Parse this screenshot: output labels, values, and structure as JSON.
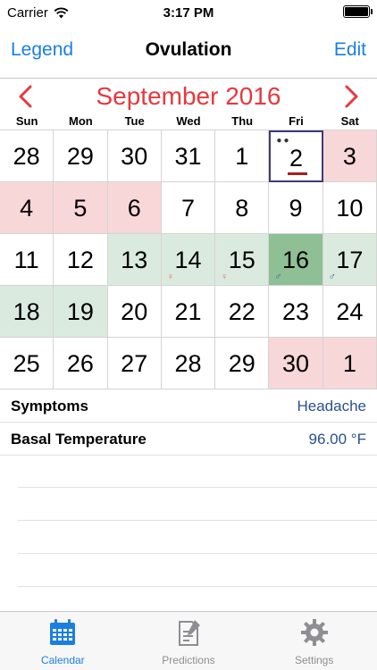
{
  "status_bar": {
    "carrier": "Carrier",
    "time": "3:17 PM"
  },
  "nav": {
    "left_label": "Legend",
    "title": "Ovulation",
    "right_label": "Edit"
  },
  "calendar": {
    "month_title": "September 2016",
    "weekdays": [
      "Sun",
      "Mon",
      "Tue",
      "Wed",
      "Thu",
      "Fri",
      "Sat"
    ],
    "weeks": [
      [
        {
          "day": "28",
          "state": "normal",
          "mark": ""
        },
        {
          "day": "29",
          "state": "normal",
          "mark": ""
        },
        {
          "day": "30",
          "state": "normal",
          "mark": ""
        },
        {
          "day": "31",
          "state": "normal",
          "mark": ""
        },
        {
          "day": "1",
          "state": "normal",
          "mark": ""
        },
        {
          "day": "2",
          "state": "today",
          "mark": ""
        },
        {
          "day": "3",
          "state": "period",
          "mark": ""
        }
      ],
      [
        {
          "day": "4",
          "state": "period",
          "mark": ""
        },
        {
          "day": "5",
          "state": "period",
          "mark": ""
        },
        {
          "day": "6",
          "state": "period",
          "mark": ""
        },
        {
          "day": "7",
          "state": "normal",
          "mark": ""
        },
        {
          "day": "8",
          "state": "normal",
          "mark": ""
        },
        {
          "day": "9",
          "state": "normal",
          "mark": ""
        },
        {
          "day": "10",
          "state": "normal",
          "mark": ""
        }
      ],
      [
        {
          "day": "11",
          "state": "normal",
          "mark": ""
        },
        {
          "day": "12",
          "state": "normal",
          "mark": ""
        },
        {
          "day": "13",
          "state": "fertile",
          "mark": ""
        },
        {
          "day": "14",
          "state": "fertile",
          "mark": "egg"
        },
        {
          "day": "15",
          "state": "fertile",
          "mark": "egg"
        },
        {
          "day": "16",
          "state": "ovulation",
          "mark": "male"
        },
        {
          "day": "17",
          "state": "fertile",
          "mark": "male"
        }
      ],
      [
        {
          "day": "18",
          "state": "fertile",
          "mark": ""
        },
        {
          "day": "19",
          "state": "fertile",
          "mark": ""
        },
        {
          "day": "20",
          "state": "normal",
          "mark": ""
        },
        {
          "day": "21",
          "state": "normal",
          "mark": ""
        },
        {
          "day": "22",
          "state": "normal",
          "mark": ""
        },
        {
          "day": "23",
          "state": "normal",
          "mark": ""
        },
        {
          "day": "24",
          "state": "normal",
          "mark": ""
        }
      ],
      [
        {
          "day": "25",
          "state": "normal",
          "mark": ""
        },
        {
          "day": "26",
          "state": "normal",
          "mark": ""
        },
        {
          "day": "27",
          "state": "normal",
          "mark": ""
        },
        {
          "day": "28",
          "state": "normal",
          "mark": ""
        },
        {
          "day": "29",
          "state": "normal",
          "mark": ""
        },
        {
          "day": "30",
          "state": "period",
          "mark": ""
        },
        {
          "day": "1",
          "state": "period",
          "mark": ""
        }
      ]
    ],
    "colors": {
      "period": "#f8d7d8",
      "fertile": "#dbeadf",
      "ovulation": "#8fbf94",
      "today_border": "#3b3b7a",
      "accent_red": "#e5393f"
    }
  },
  "details": [
    {
      "label": "Symptoms",
      "value": "Headache"
    },
    {
      "label": "Basal Temperature",
      "value": "96.00 °F"
    }
  ],
  "tabs": [
    {
      "label": "Calendar",
      "icon": "calendar-icon",
      "active": true
    },
    {
      "label": "Predictions",
      "icon": "predictions-icon",
      "active": false
    },
    {
      "label": "Settings",
      "icon": "gear-icon",
      "active": false
    }
  ]
}
